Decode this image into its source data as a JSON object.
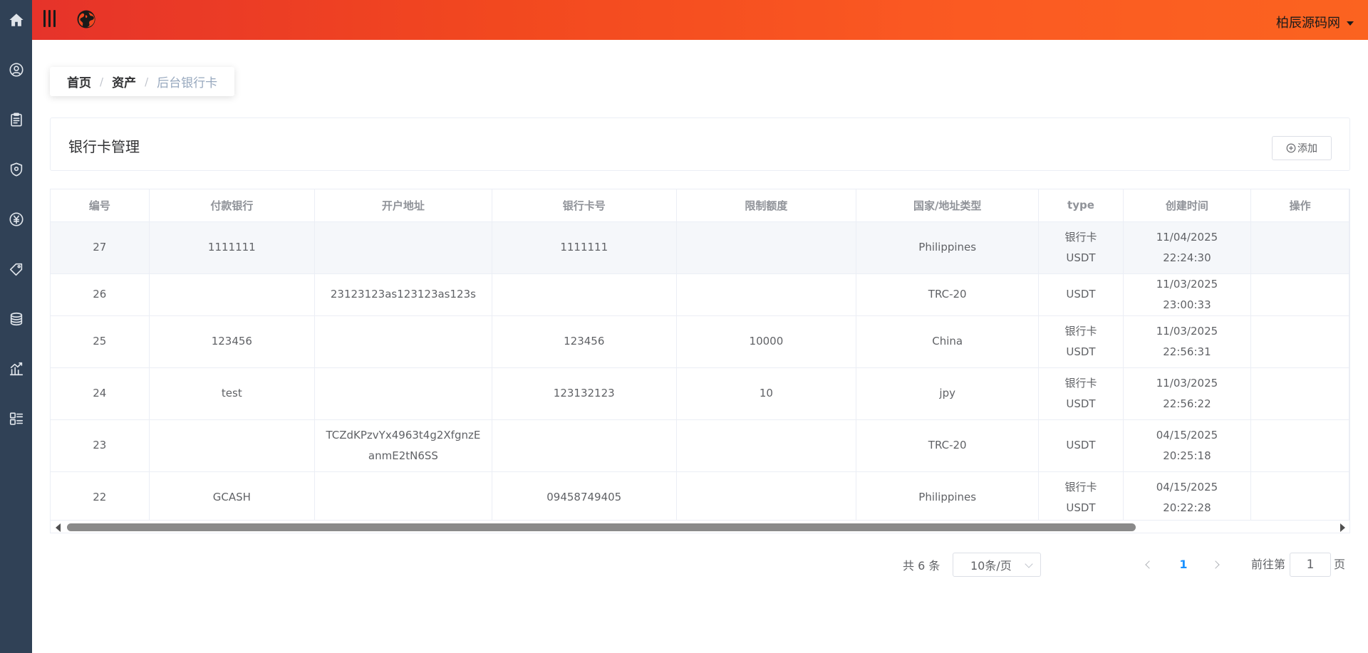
{
  "header": {
    "user_name": "柏辰源码网"
  },
  "breadcrumb": {
    "home": "首页",
    "assets": "资产",
    "current": "后台银行卡"
  },
  "card": {
    "title": "银行卡管理",
    "add_label": "添加"
  },
  "table": {
    "columns": [
      "编号",
      "付款银行",
      "开户地址",
      "银行卡号",
      "限制额度",
      "国家/地址类型",
      "type",
      "创建时间",
      "操作"
    ],
    "rows": [
      {
        "id": "27",
        "bank": "1111111",
        "address": "",
        "card_no": "1111111",
        "limit": "",
        "country": "Philippines",
        "type_line1": "银行卡",
        "type_line2": "USDT",
        "created": "11/04/2025 22:24:30"
      },
      {
        "id": "26",
        "bank": "",
        "address": "23123123as123123as123s",
        "card_no": "",
        "limit": "",
        "country": "TRC-20",
        "type_line1": "USDT",
        "type_line2": "",
        "created": "11/03/2025 23:00:33"
      },
      {
        "id": "25",
        "bank": "123456",
        "address": "",
        "card_no": "123456",
        "limit": "10000",
        "country": "China",
        "type_line1": "银行卡",
        "type_line2": "USDT",
        "created": "11/03/2025 22:56:31"
      },
      {
        "id": "24",
        "bank": "test",
        "address": "",
        "card_no": "123132123",
        "limit": "10",
        "country": "jpy",
        "type_line1": "银行卡",
        "type_line2": "USDT",
        "created": "11/03/2025 22:56:22"
      },
      {
        "id": "23",
        "bank": "",
        "address": "TCZdKPzvYx4963t4g2XfgnzEanmE2tN6SS",
        "card_no": "",
        "limit": "",
        "country": "TRC-20",
        "type_line1": "USDT",
        "type_line2": "",
        "created": "04/15/2025 20:25:18"
      },
      {
        "id": "22",
        "bank": "GCASH",
        "address": "",
        "card_no": "09458749405",
        "limit": "",
        "country": "Philippines",
        "type_line1": "银行卡",
        "type_line2": "USDT",
        "created": "04/15/2025 20:22:28"
      }
    ]
  },
  "pagination": {
    "total_text": "共 6 条",
    "page_size": "10条/页",
    "current_page": "1",
    "goto_prefix": "前往第",
    "goto_value": "1",
    "goto_suffix": "页"
  },
  "colors": {
    "sidebar_bg": "#304156",
    "header_gradient_start": "#e6332a",
    "header_gradient_end": "#fb6320",
    "active_page": "#1890ff"
  },
  "icons": {
    "sidebar": [
      "home-icon",
      "user-circle-icon",
      "clipboard-icon",
      "shield-icon",
      "yuan-icon",
      "tag-icon",
      "coins-icon",
      "chart-icon",
      "app-list-icon"
    ],
    "header": [
      "hamburger-icon",
      "globe-icon",
      "caret-down-icon"
    ]
  }
}
